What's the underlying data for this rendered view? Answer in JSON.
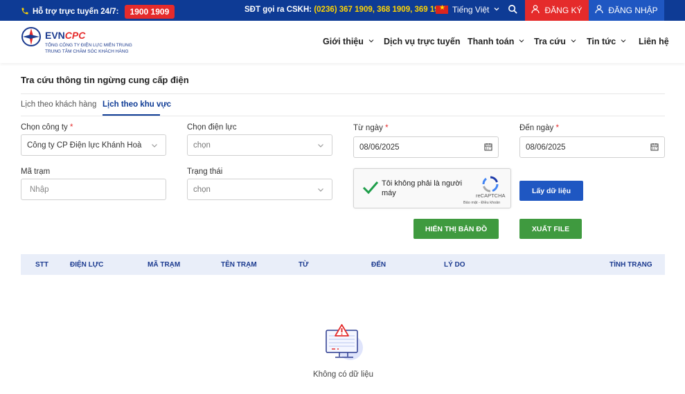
{
  "topbar": {
    "hotline_label": "Hỗ trợ trực tuyến 24/7:",
    "hotline_number": "1900 1909",
    "cskh_label": "SĐT gọi ra CSKH:",
    "cskh_numbers": "(0236) 367 1909, 368 1909, 369 1909",
    "language": "Tiếng Việt",
    "register": "ĐĂNG KÝ",
    "login": "ĐĂNG NHẬP"
  },
  "logo": {
    "brand_a": "EVN",
    "brand_b": "CPC",
    "line1": "TỔNG CÔNG TY ĐIỆN LỰC MIỀN TRUNG",
    "line2": "TRUNG TÂM CHĂM SÓC KHÁCH HÀNG"
  },
  "nav": {
    "intro": "Giới thiệu",
    "online": "Dịch vụ trực tuyến",
    "payment": "Thanh toán",
    "lookup": "Tra cứu",
    "news": "Tin tức",
    "contact": "Liên hệ"
  },
  "page": {
    "title": "Tra cứu thông tin ngừng cung cấp điện",
    "tab_customer": "Lịch theo khách hàng",
    "tab_area": "Lịch theo khu vực"
  },
  "form": {
    "company_label": "Chọn công ty",
    "company_value": "Công ty CP Điện lực Khánh Hoà",
    "power_label": "Chọn điện lực",
    "power_value": "chọn",
    "from_label": "Từ ngày",
    "from_value": "08/06/2025",
    "to_label": "Đến ngày",
    "to_value": "08/06/2025",
    "station_label": "Mã trạm",
    "station_placeholder": "Nhập",
    "status_label": "Trạng thái",
    "status_value": "chọn",
    "required_mark": "*"
  },
  "captcha": {
    "text": "Tôi không phải là người máy",
    "brand": "reCAPTCHA",
    "links": "Bảo mật - Điều khoản"
  },
  "buttons": {
    "fetch": "Lấy dữ liệu",
    "map": "HIỂN THỊ BẢN ĐỒ",
    "export": "XUẤT FILE"
  },
  "table": {
    "headers": [
      "STT",
      "ĐIỆN LỰC",
      "MÃ TRẠM",
      "TÊN TRẠM",
      "TỪ",
      "ĐẾN",
      "LÝ DO",
      "TÌNH TRẠNG"
    ]
  },
  "empty": {
    "text": "Không có dữ liệu"
  },
  "colors": {
    "primary": "#0e3b95",
    "accent_red": "#e52b2b",
    "button_blue": "#1f57c2",
    "button_green": "#3f9a3f",
    "table_header": "#e9eef9"
  }
}
